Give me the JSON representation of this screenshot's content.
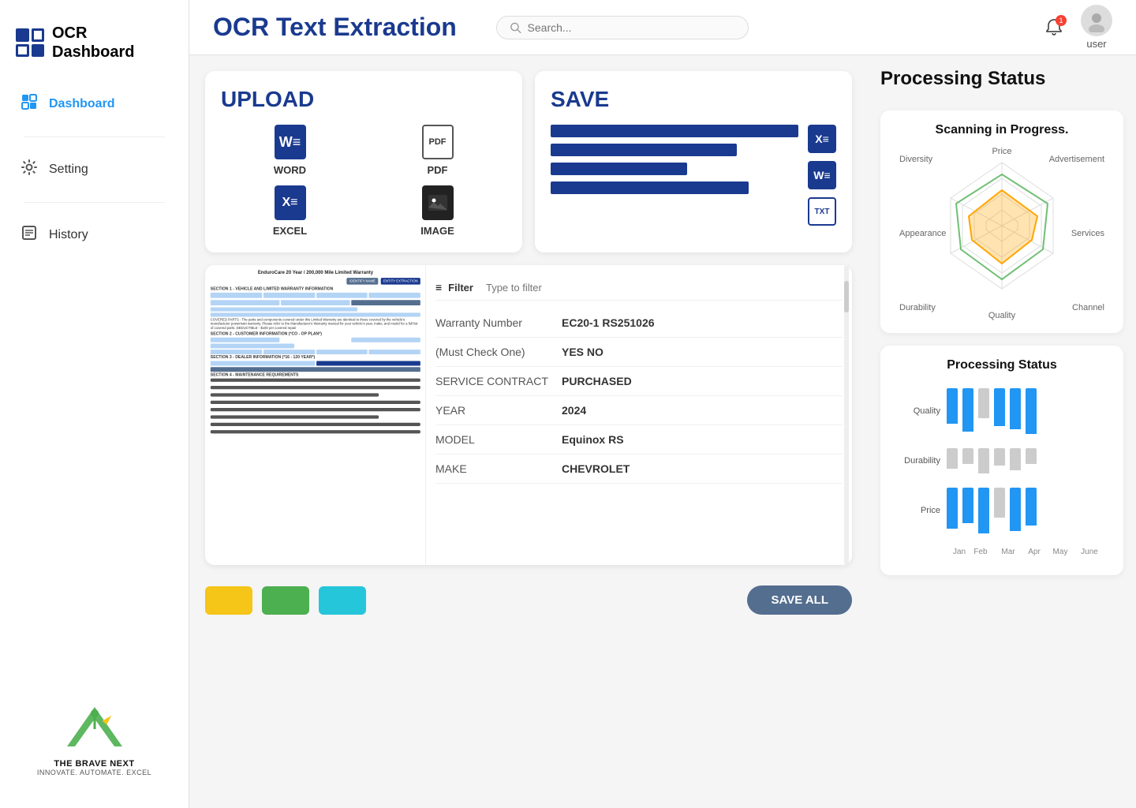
{
  "sidebar": {
    "logo_line1": "OCR",
    "logo_line2": "Dashboard",
    "nav_items": [
      {
        "id": "dashboard",
        "label": "Dashboard",
        "icon": "grid",
        "active": true
      },
      {
        "id": "setting",
        "label": "Setting",
        "icon": "gear",
        "active": false
      },
      {
        "id": "history",
        "label": "History",
        "icon": "doc",
        "active": false
      }
    ],
    "brand_name": "THE BRAVE NEXT",
    "brand_tagline": "INNOVATE. AUTOMATE. EXCEL"
  },
  "header": {
    "title": "OCR Text Extraction",
    "search_placeholder": "Search...",
    "notification_count": "1",
    "user_label": "user"
  },
  "upload_card": {
    "title": "UPLOAD",
    "formats": [
      {
        "id": "word",
        "label": "WORD"
      },
      {
        "id": "pdf",
        "label": "PDF"
      },
      {
        "id": "excel",
        "label": "EXCEL"
      },
      {
        "id": "image",
        "label": "IMAGE"
      }
    ]
  },
  "save_card": {
    "title": "SAVE",
    "formats": [
      {
        "id": "excel",
        "label": "excel-icon"
      },
      {
        "id": "word",
        "label": "word-icon"
      },
      {
        "id": "txt",
        "label": "TXT"
      }
    ],
    "bars": [
      100,
      75,
      55,
      80
    ]
  },
  "document": {
    "filter_placeholder": "Type to filter",
    "fields": [
      {
        "key": "Warranty Number",
        "value": "EC20-1 RS251026"
      },
      {
        "key": "(Must Check One)",
        "value": "YES NO"
      },
      {
        "key": "SERVICE CONTRACT",
        "value": "PURCHASED"
      },
      {
        "key": "YEAR",
        "value": "2024"
      },
      {
        "key": "MODEL",
        "value": "Equinox RS"
      },
      {
        "key": "MAKE",
        "value": "CHEVROLET"
      }
    ]
  },
  "bottom_toolbar": {
    "save_all_label": "SAVE ALL",
    "colors": [
      "#f5c518",
      "#4caf50",
      "#26c6da"
    ]
  },
  "processing_status_1": {
    "title": "Processing Status",
    "scanning_label": "Scanning in Progress.",
    "radar_labels": {
      "top": "Price",
      "top_right": "Advertisement",
      "right": "Services",
      "bottom_right": "Channel",
      "bottom": "Quality",
      "bottom_left": "Durability",
      "left": "Appearance",
      "top_left": "Diversity"
    }
  },
  "processing_status_2": {
    "title": "Processing Status",
    "row_labels": [
      "Quality",
      "Durability",
      "Price"
    ],
    "x_labels": [
      "Jan",
      "Feb",
      "Mar",
      "Apr",
      "May",
      "June"
    ],
    "bars": {
      "Quality": [
        70,
        85,
        60,
        75,
        80,
        90
      ],
      "Durability": [
        40,
        30,
        50,
        35,
        45,
        30
      ],
      "Price": [
        80,
        70,
        90,
        60,
        85,
        75
      ]
    }
  }
}
